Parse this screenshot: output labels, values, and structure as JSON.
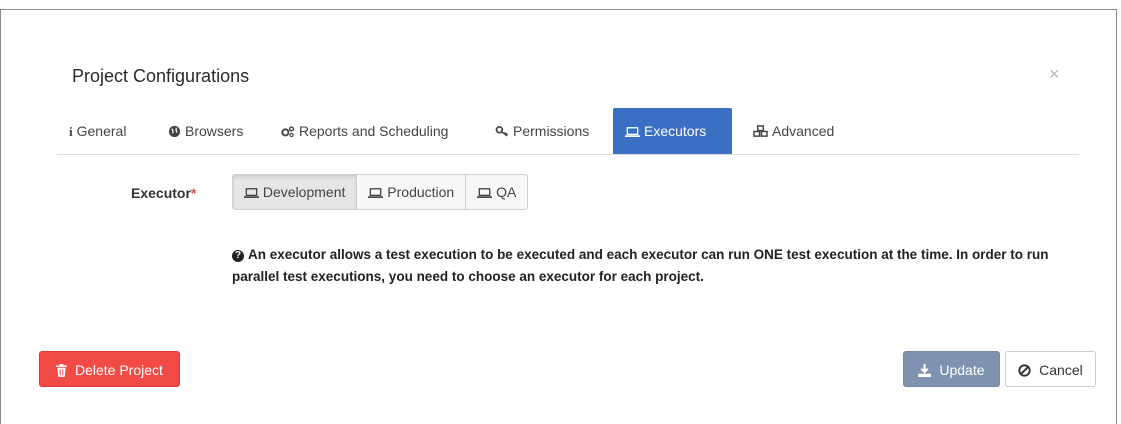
{
  "dialog": {
    "title": "Project Configurations",
    "close_label": "×"
  },
  "tabs": [
    {
      "label": "General",
      "icon": "info-icon",
      "active": false
    },
    {
      "label": "Browsers",
      "icon": "globe-icon",
      "active": false
    },
    {
      "label": "Reports and Scheduling",
      "icon": "cogs-icon",
      "active": false
    },
    {
      "label": "Permissions",
      "icon": "key-icon",
      "active": false
    },
    {
      "label": "Executors",
      "icon": "laptop-icon",
      "active": true
    },
    {
      "label": "Advanced",
      "icon": "cubes-icon",
      "active": false
    }
  ],
  "executor": {
    "label": "Executor",
    "required_mark": "*",
    "options": [
      "Development",
      "Production",
      "QA"
    ],
    "selected": "Development",
    "help_text": "An executor allows a test execution to be executed and each executor can run ONE test execution at the time. In order to run parallel test executions, you need to choose an executor for each project."
  },
  "actions": {
    "delete_label": "Delete Project",
    "update_label": "Update",
    "cancel_label": "Cancel"
  },
  "colors": {
    "active_tab": "#3a6fc4",
    "delete": "#f24a44",
    "update": "#7d93b0"
  }
}
